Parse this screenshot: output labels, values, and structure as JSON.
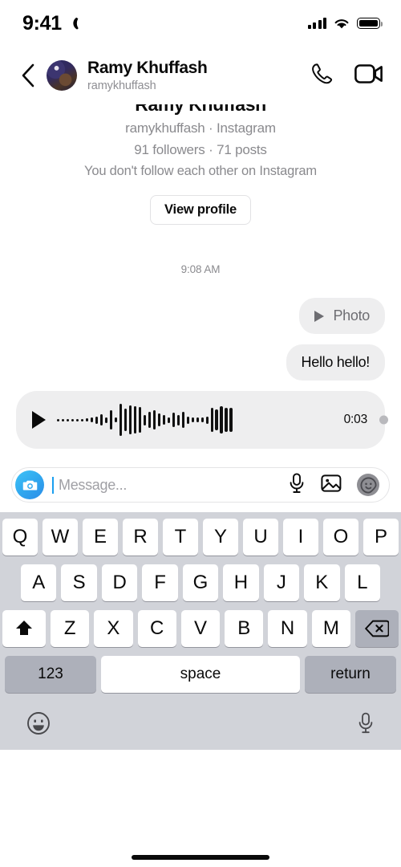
{
  "status_bar": {
    "time": "9:41",
    "moon_icon": "crescent-moon-icon",
    "signal_icon": "cellular-signal-icon",
    "wifi_icon": "wifi-icon",
    "battery_icon": "battery-full-icon"
  },
  "header": {
    "back_icon": "chevron-left-icon",
    "avatar": "contact-avatar",
    "name": "Ramy Khuffash",
    "username": "ramykhuffash",
    "call_icon": "phone-icon",
    "video_icon": "video-camera-icon"
  },
  "profile_card": {
    "name": "Ramy Khuffash",
    "handle_line": "ramykhuffash · Instagram",
    "stats_line": "91 followers · 71 posts",
    "follow_note": "You don't follow each other on Instagram",
    "view_profile_label": "View profile"
  },
  "thread": {
    "daystamp": "9:08 AM",
    "messages": [
      {
        "type": "photo",
        "label": "Photo",
        "play_icon": "play-triangle-icon"
      },
      {
        "type": "text",
        "text": "Hello hello!"
      },
      {
        "type": "voice",
        "duration": "0:03",
        "play_icon": "play-triangle-icon",
        "waveform": [
          3,
          3,
          3,
          3,
          3,
          3,
          4,
          6,
          9,
          14,
          7,
          24,
          6,
          40,
          28,
          36,
          34,
          32,
          13,
          20,
          24,
          16,
          12,
          7,
          18,
          13,
          20,
          9,
          6,
          6,
          6,
          9,
          30,
          26,
          34,
          30,
          30
        ]
      }
    ]
  },
  "composer": {
    "camera_icon": "camera-icon",
    "placeholder": "Message...",
    "mic_icon": "microphone-icon",
    "gallery_icon": "photo-gallery-icon",
    "sticker_icon": "sticker-face-icon"
  },
  "keyboard": {
    "row1": [
      "Q",
      "W",
      "E",
      "R",
      "T",
      "Y",
      "U",
      "I",
      "O",
      "P"
    ],
    "row2": [
      "A",
      "S",
      "D",
      "F",
      "G",
      "H",
      "J",
      "K",
      "L"
    ],
    "row3": [
      "Z",
      "X",
      "C",
      "V",
      "B",
      "N",
      "M"
    ],
    "shift_icon": "shift-arrow-icon",
    "backspace_icon": "backspace-icon",
    "numbers_label": "123",
    "space_label": "space",
    "return_label": "return",
    "emoji_icon": "emoji-smiley-icon",
    "dictation_icon": "microphone-icon"
  },
  "home_indicator": "home-indicator",
  "colors": {
    "accent_blue": "#31a9ef",
    "bubble_gray": "#eeeeef",
    "keyboard_bg": "#d1d3d9",
    "muted_text": "#8a8a8e"
  }
}
